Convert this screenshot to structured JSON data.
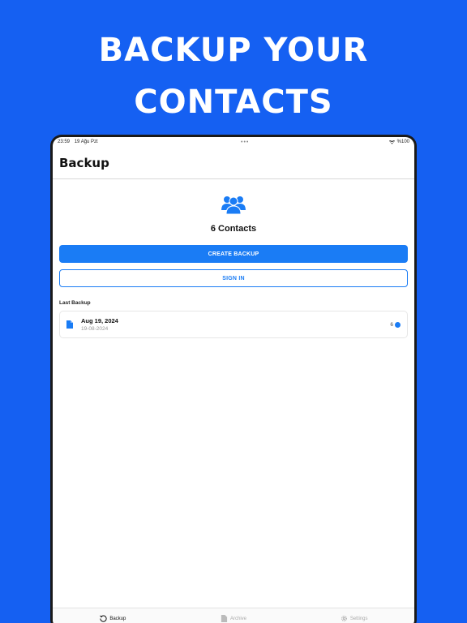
{
  "headline": {
    "line1": "BACKUP YOUR",
    "line2": "CONTACTS"
  },
  "status_bar": {
    "time": "23:59",
    "date": "19 Ağu Pzt",
    "dots": "•••",
    "battery": "%100"
  },
  "header": {
    "title": "Backup"
  },
  "summary": {
    "contacts_label": "6 Contacts"
  },
  "actions": {
    "create_backup": "CREATE BACKUP",
    "sign_in": "SIGN IN"
  },
  "last_backup": {
    "label": "Last Backup",
    "date": "Aug 19, 2024",
    "sub_date": "19-08-2024",
    "count": "6"
  },
  "tabs": [
    {
      "label": "Backup",
      "icon": "refresh-icon",
      "active": true
    },
    {
      "label": "Archive",
      "icon": "file-icon",
      "active": false
    },
    {
      "label": "Settings",
      "icon": "gear-icon",
      "active": false
    }
  ],
  "colors": {
    "background": "#1560f2",
    "accent": "#1a7cf5"
  }
}
